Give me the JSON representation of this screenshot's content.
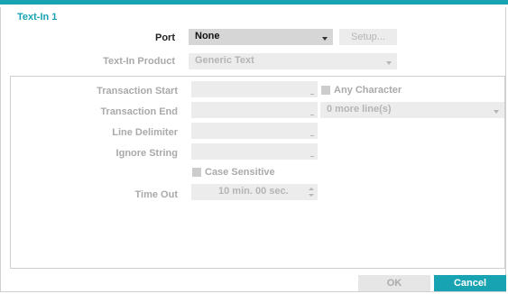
{
  "dialog": {
    "title": "Text-In 1"
  },
  "form": {
    "port": {
      "label": "Port",
      "value": "None",
      "setup_label": "Setup..."
    },
    "product": {
      "label": "Text-In Product",
      "value": "Generic Text"
    }
  },
  "settings": {
    "transaction_start": {
      "label": "Transaction Start",
      "value": ""
    },
    "any_character": {
      "label": "Any Character",
      "checked": false
    },
    "transaction_end": {
      "label": "Transaction End",
      "value": ""
    },
    "more_lines": {
      "value": "0 more line(s)"
    },
    "line_delimiter": {
      "label": "Line Delimiter",
      "value": ""
    },
    "ignore_string": {
      "label": "Ignore String",
      "value": ""
    },
    "case_sensitive": {
      "label": "Case Sensitive",
      "checked": false
    },
    "time_out": {
      "label": "Time Out",
      "value": "10 min. 00 sec."
    }
  },
  "footer": {
    "ok_label": "OK",
    "cancel_label": "Cancel"
  },
  "colors": {
    "accent": "#18a3b3",
    "disabled_text": "#aaaaaa",
    "field_bg": "#ececec"
  }
}
